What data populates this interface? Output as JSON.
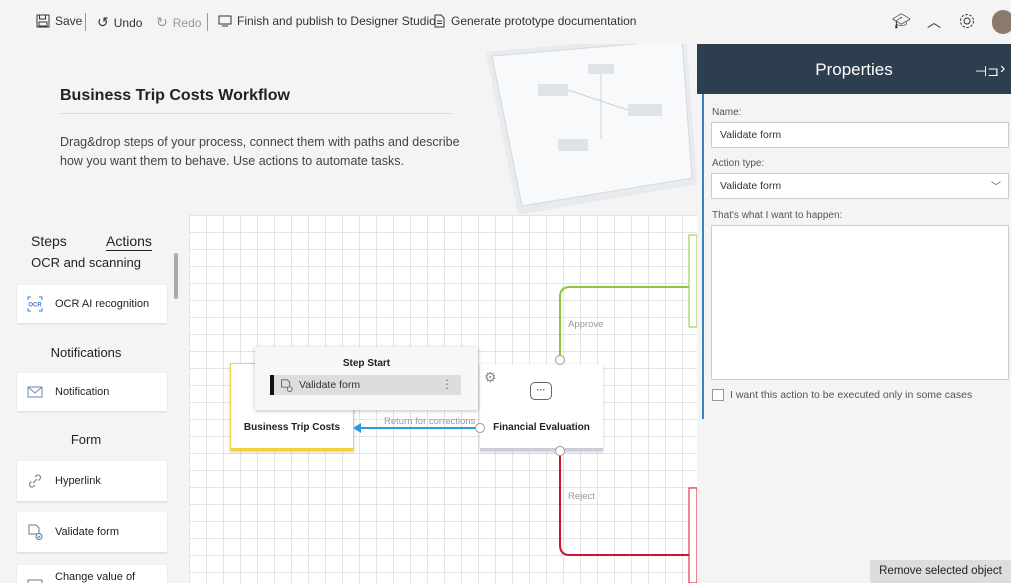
{
  "toolbar": {
    "save": "Save",
    "undo": "Undo",
    "redo": "Redo",
    "publish": "Finish and publish to Designer Studio",
    "generate_docs": "Generate prototype documentation"
  },
  "intro": {
    "title": "Business Trip Costs Workflow",
    "description": "Drag&drop steps of your process, connect them with paths and describe how you want them to behave. Use actions to automate tasks."
  },
  "palette": {
    "tabs": [
      "Steps",
      "Actions"
    ],
    "active_tab": "Actions",
    "categories": [
      {
        "name": "OCR and scanning",
        "items": [
          {
            "label": "OCR AI recognition",
            "icon": "ocr-icon"
          }
        ]
      },
      {
        "name": "Notifications",
        "items": [
          {
            "label": "Notification",
            "icon": "envelope-icon"
          }
        ]
      },
      {
        "name": "Form",
        "items": [
          {
            "label": "Hyperlink",
            "icon": "link-icon"
          },
          {
            "label": "Validate form",
            "icon": "validate-form-icon"
          },
          {
            "label": "Change value of",
            "icon": "change-value-icon"
          }
        ]
      }
    ]
  },
  "canvas": {
    "step_start_popup": {
      "title": "Step Start",
      "action": "Validate form"
    },
    "nodes": {
      "business_trip_costs": "Business Trip Costs",
      "financial_evaluation": "Financial Evaluation"
    },
    "paths": {
      "approve": "Approve",
      "return": "Return for corrections",
      "reject": "Reject"
    },
    "path_colors": {
      "approve": "#8dc63f",
      "return": "#2b9be0",
      "reject": "#d0112b"
    }
  },
  "properties": {
    "title": "Properties",
    "name_label": "Name:",
    "name_value": "Validate form",
    "action_type_label": "Action type:",
    "action_type_value": "Validate form",
    "happen_label": "That's what I want to happen:",
    "conditional_label": "I want this action to be executed only in some cases",
    "remove_button": "Remove selected object"
  },
  "colors": {
    "panel_header": "#2d3e4f",
    "accent_blue": "#3b7fc4"
  }
}
